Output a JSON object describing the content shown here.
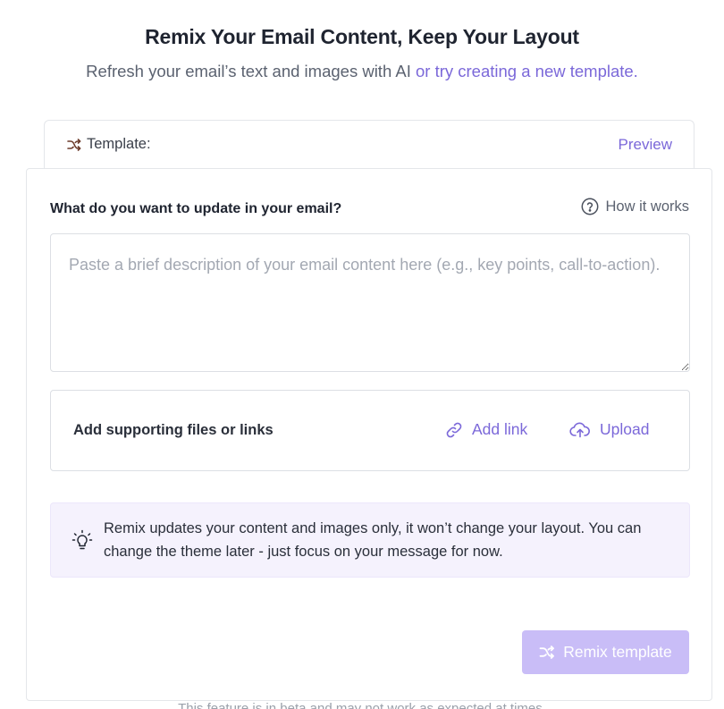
{
  "header": {
    "title": "Remix Your Email Content, Keep Your Layout",
    "subtitle_prefix": "Refresh your email’s text and images with AI ",
    "subtitle_link": "or try creating a new template."
  },
  "template_bar": {
    "icon": "shuffle-icon",
    "label": "Template:",
    "preview": "Preview"
  },
  "form": {
    "question": "What do you want to update in your email?",
    "how_it_works": "How it works",
    "textarea_value": "",
    "textarea_placeholder": "Paste a brief description of your email content here (e.g., key points, call-to-action)."
  },
  "files": {
    "label": "Add supporting files or links",
    "add_link": "Add link",
    "upload": "Upload"
  },
  "info": {
    "icon": "lightbulb-icon",
    "text": "Remix updates your content and images only, it won’t change your layout. You can change the theme later - just focus on your message for now."
  },
  "actions": {
    "remix_label": "Remix template"
  },
  "footer": {
    "cut_text": "This feature is in beta and may not work as expected at times."
  },
  "colors": {
    "accent": "#7b68d9",
    "button_disabled": "#c9bdf7",
    "info_bg": "#f5f2fd"
  }
}
